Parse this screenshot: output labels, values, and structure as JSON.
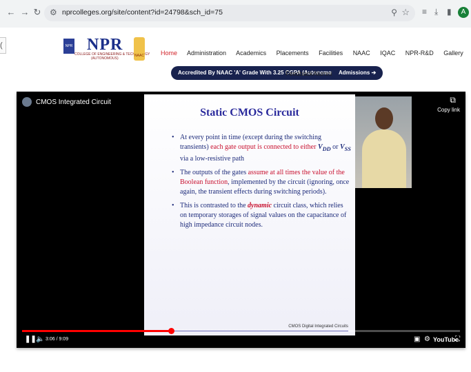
{
  "browser": {
    "url": "nprcolleges.org/site/content?id=24798&sch_id=75",
    "profile_initial": "A"
  },
  "site": {
    "logo_text": "NPR",
    "logo_subtitle": "COLLEGE OF ENGINEERING & TECHNOLOGY",
    "logo_autonomous": "(AUTONOMOUS)",
    "naac_text": "NAAC",
    "nav": [
      "Home",
      "Administration",
      "Academics",
      "Placements",
      "Facilities",
      "NAAC",
      "IQAC",
      "NPR-R&D",
      "Gallery"
    ],
    "accredited": "Accredited By NAAC 'A' Grade With 3.25 CGPA (Autonomous)",
    "feedback": "Feedback",
    "alumni": "Alumni",
    "admissions": "Admissions"
  },
  "video": {
    "title": "CMOS Integrated Circuit",
    "copy_link": "Copy link",
    "time": "3:06 / 9:09",
    "progress": 0.34,
    "youtube": "YouTube",
    "slide": {
      "title": "Static CMOS Circuit",
      "b1_a": "At every point in time (except during the switching transients) ",
      "b1_red": "each gate output is connected to either ",
      "b1_vdd": "V",
      "b1_vdd_sub": "DD",
      "b1_or": " or ",
      "b1_vss": "V",
      "b1_vss_sub": "SS",
      "b1_end": " via a low-resistive path",
      "b2_a": "The outputs of the gates ",
      "b2_red": "assume at all times the value of the Boolean function",
      "b2_end": ", implemented by the circuit (ignoring, once again, the transient effects during switching periods).",
      "b3_a": "This is contrasted to the ",
      "b3_red": "dynamic",
      "b3_end": " circuit class, which relies on temporary storages of signal values on the capacitance of high impedance circuit nodes.",
      "footer": "CMOS Digital Integrated Circuits"
    }
  }
}
